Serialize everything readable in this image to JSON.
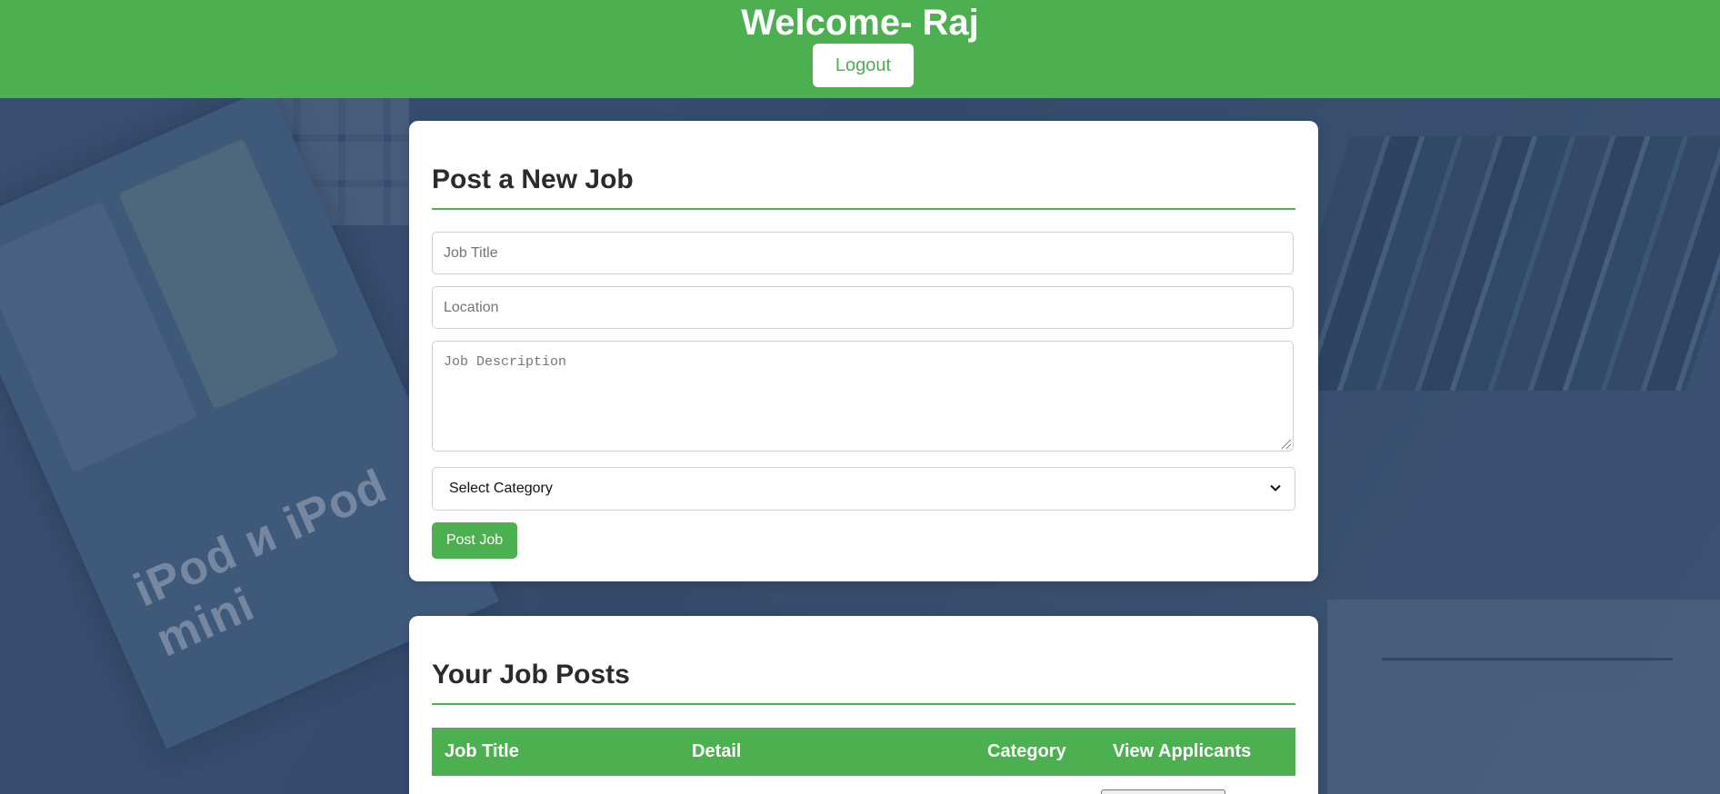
{
  "header": {
    "title": "Welcome- Raj",
    "logout_label": "Logout"
  },
  "post_form": {
    "heading": "Post a New Job",
    "job_title_placeholder": "Job Title",
    "location_placeholder": "Location",
    "description_placeholder": "Job Description",
    "category_selected": "Select Category",
    "submit_label": "Post Job"
  },
  "job_posts": {
    "heading": "Your Job Posts",
    "columns": [
      "Job Title",
      "Detail",
      "Category",
      "View Applicants"
    ]
  },
  "background_text": {
    "brand": "iPod и iPod mini"
  },
  "colors": {
    "accent": "#4caf50",
    "header_text": "#ffffff",
    "card_bg": "#ffffff"
  },
  "icons": {
    "select_arrow": "chevron-down-icon",
    "textarea_resize": "resize-grip-icon"
  }
}
